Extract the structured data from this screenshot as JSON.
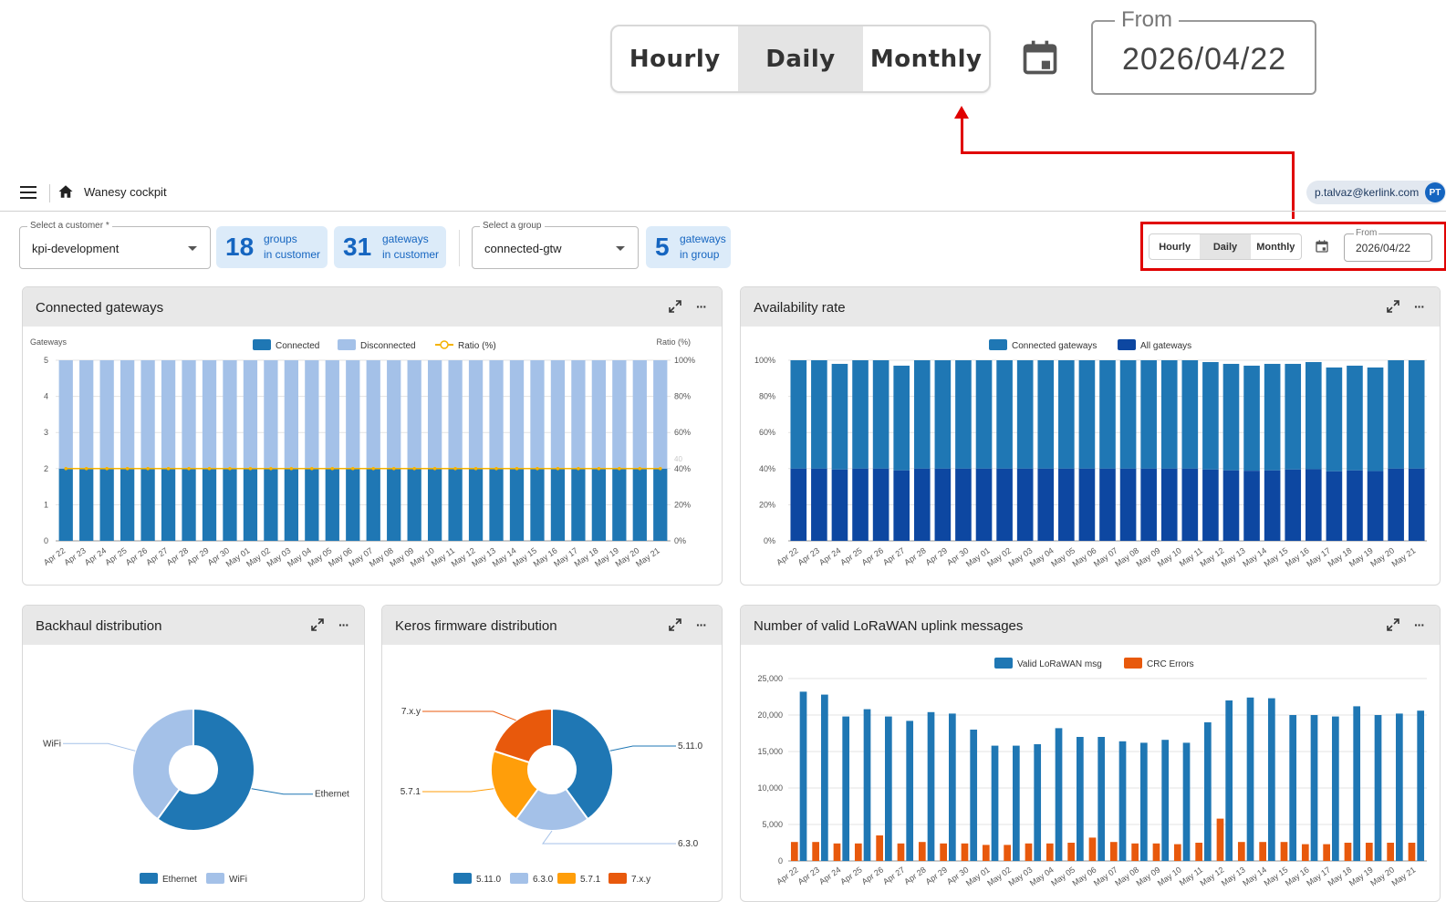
{
  "zoom": {
    "periods": [
      "Hourly",
      "Daily",
      "Monthly"
    ],
    "active": "Daily",
    "date_label": "From",
    "date_value": "2026/04/22"
  },
  "app": {
    "title": "Wanesy cockpit",
    "user_email": "p.talvaz@kerlink.com",
    "user_initials": "PT"
  },
  "filters": {
    "customer_label": "Select a customer *",
    "customer_value": "kpi-development",
    "group_label": "Select a group",
    "group_value": "connected-gtw"
  },
  "kpis": [
    {
      "num": "18",
      "l1": "groups",
      "l2": "in customer"
    },
    {
      "num": "31",
      "l1": "gateways",
      "l2": "in customer"
    },
    {
      "num": "5",
      "l1": "gateways",
      "l2": "in group"
    }
  ],
  "toolbar": {
    "periods": [
      "Hourly",
      "Daily",
      "Monthly"
    ],
    "active": "Daily",
    "date_label": "From",
    "date_value": "2026/04/22"
  },
  "cards": {
    "connected": "Connected gateways",
    "availability": "Availability rate",
    "backhaul": "Backhaul distribution",
    "firmware": "Keros firmware distribution",
    "uplink": "Number of valid LoRaWAN uplink messages"
  },
  "colors": {
    "primary": "#1f77b4",
    "light": "#a4c1e8",
    "dark_blue": "#0d47a1",
    "orange": "#ff9e0a",
    "red_orange": "#e8590c",
    "ratio_line": "#f5b301",
    "accent": "#1565c0",
    "highlight": "#e00000"
  },
  "icons": {
    "menu": "menu-icon",
    "home": "home-icon",
    "calendar": "calendar-icon",
    "expand": "expand-icon",
    "more": "more-icon"
  },
  "chart_data": [
    {
      "type": "bar",
      "title": "Connected gateways",
      "ylabel": "Gateways",
      "y2label": "Ratio (%)",
      "ylim": [
        0,
        5
      ],
      "y_ticks": [
        "0",
        "1",
        "2",
        "3",
        "4",
        "5"
      ],
      "y2lim": [
        0,
        100
      ],
      "y2_ticks": [
        "0%",
        "20%",
        "40%",
        "60%",
        "80%",
        "100%"
      ],
      "legend": "top",
      "categories": [
        "Apr 22",
        "Apr 23",
        "Apr 24",
        "Apr 25",
        "Apr 26",
        "Apr 27",
        "Apr 28",
        "Apr 29",
        "Apr 30",
        "May 01",
        "May 02",
        "May 03",
        "May 04",
        "May 05",
        "May 06",
        "May 07",
        "May 08",
        "May 09",
        "May 10",
        "May 11",
        "May 12",
        "May 13",
        "May 14",
        "May 15",
        "May 16",
        "May 17",
        "May 18",
        "May 19",
        "May 20",
        "May 21"
      ],
      "series": [
        {
          "name": "Connected",
          "values": [
            2,
            2,
            2,
            2,
            2,
            2,
            2,
            2,
            2,
            2,
            2,
            2,
            2,
            2,
            2,
            2,
            2,
            2,
            2,
            2,
            2,
            2,
            2,
            2,
            2,
            2,
            2,
            2,
            2,
            2
          ]
        },
        {
          "name": "Disconnected",
          "values": [
            3,
            3,
            3,
            3,
            3,
            3,
            3,
            3,
            3,
            3,
            3,
            3,
            3,
            3,
            3,
            3,
            3,
            3,
            3,
            3,
            3,
            3,
            3,
            3,
            3,
            3,
            3,
            3,
            3,
            3
          ]
        },
        {
          "name": "Ratio (%)",
          "values": [
            40,
            40,
            40,
            40,
            40,
            40,
            40,
            40,
            40,
            40,
            40,
            40,
            40,
            40,
            40,
            40,
            40,
            40,
            40,
            40,
            40,
            40,
            40,
            40,
            40,
            40,
            40,
            40,
            40,
            40
          ]
        }
      ],
      "annotation": "40"
    },
    {
      "type": "bar",
      "title": "Availability rate",
      "ylim": [
        0,
        100
      ],
      "y_ticks": [
        "0%",
        "20%",
        "40%",
        "60%",
        "80%",
        "100%"
      ],
      "legend": "top",
      "categories": [
        "Apr 22",
        "Apr 23",
        "Apr 24",
        "Apr 25",
        "Apr 26",
        "Apr 27",
        "Apr 28",
        "Apr 29",
        "Apr 30",
        "May 01",
        "May 02",
        "May 03",
        "May 04",
        "May 05",
        "May 06",
        "May 07",
        "May 08",
        "May 09",
        "May 10",
        "May 11",
        "May 12",
        "May 13",
        "May 14",
        "May 15",
        "May 16",
        "May 17",
        "May 18",
        "May 19",
        "May 20",
        "May 21"
      ],
      "series": [
        {
          "name": "Connected gateways",
          "values": [
            100,
            100,
            98,
            100,
            100,
            97,
            100,
            100,
            100,
            100,
            100,
            100,
            100,
            100,
            100,
            100,
            100,
            100,
            100,
            100,
            99,
            98,
            97,
            98,
            98,
            99,
            96,
            97,
            96,
            100,
            100
          ]
        },
        {
          "name": "All gateways",
          "values": [
            40,
            40,
            39.5,
            40,
            40,
            39,
            40,
            40,
            40,
            40,
            40,
            40,
            40,
            40,
            40,
            40,
            40,
            40,
            40,
            40,
            39.5,
            39,
            38.8,
            39,
            39.5,
            39.7,
            38.5,
            39,
            38.6,
            40,
            40
          ]
        }
      ]
    },
    {
      "type": "pie",
      "title": "Backhaul distribution",
      "legend": "bottom",
      "labels": [
        "Ethernet",
        "WiFi"
      ],
      "values": [
        60,
        40
      ]
    },
    {
      "type": "pie",
      "title": "Keros firmware distribution",
      "legend": "bottom",
      "labels": [
        "5.11.0",
        "6.3.0",
        "5.7.1",
        "7.x.y"
      ],
      "values": [
        40,
        20,
        20,
        20
      ]
    },
    {
      "type": "bar",
      "title": "Number of valid LoRaWAN uplink messages",
      "ylim": [
        0,
        25000
      ],
      "y_ticks": [
        "0",
        "5,000",
        "10,000",
        "15,000",
        "20,000",
        "25,000"
      ],
      "legend": "top",
      "categories": [
        "Apr 22",
        "Apr 23",
        "Apr 24",
        "Apr 25",
        "Apr 26",
        "Apr 27",
        "Apr 28",
        "Apr 29",
        "Apr 30",
        "May 01",
        "May 02",
        "May 03",
        "May 04",
        "May 05",
        "May 06",
        "May 07",
        "May 08",
        "May 09",
        "May 10",
        "May 11",
        "May 12",
        "May 13",
        "May 14",
        "May 15",
        "May 16",
        "May 17",
        "May 18",
        "May 19",
        "May 20",
        "May 21"
      ],
      "series": [
        {
          "name": "Valid LoRaWAN msg",
          "values": [
            23200,
            22800,
            19800,
            20800,
            19800,
            19200,
            20400,
            20200,
            18000,
            15800,
            15800,
            16000,
            18200,
            17000,
            17000,
            16400,
            16200,
            16600,
            16200,
            19000,
            22000,
            22400,
            22300,
            20000,
            20000,
            19800,
            21200,
            20000,
            20200,
            20600
          ]
        },
        {
          "name": "CRC Errors",
          "values": [
            2600,
            2600,
            2400,
            2400,
            3500,
            2400,
            2600,
            2400,
            2400,
            2200,
            2200,
            2400,
            2400,
            2500,
            3200,
            2600,
            2400,
            2400,
            2300,
            2500,
            5800,
            2600,
            2600,
            2600,
            2300,
            2300,
            2500,
            2500,
            2500,
            2500
          ]
        }
      ]
    }
  ]
}
